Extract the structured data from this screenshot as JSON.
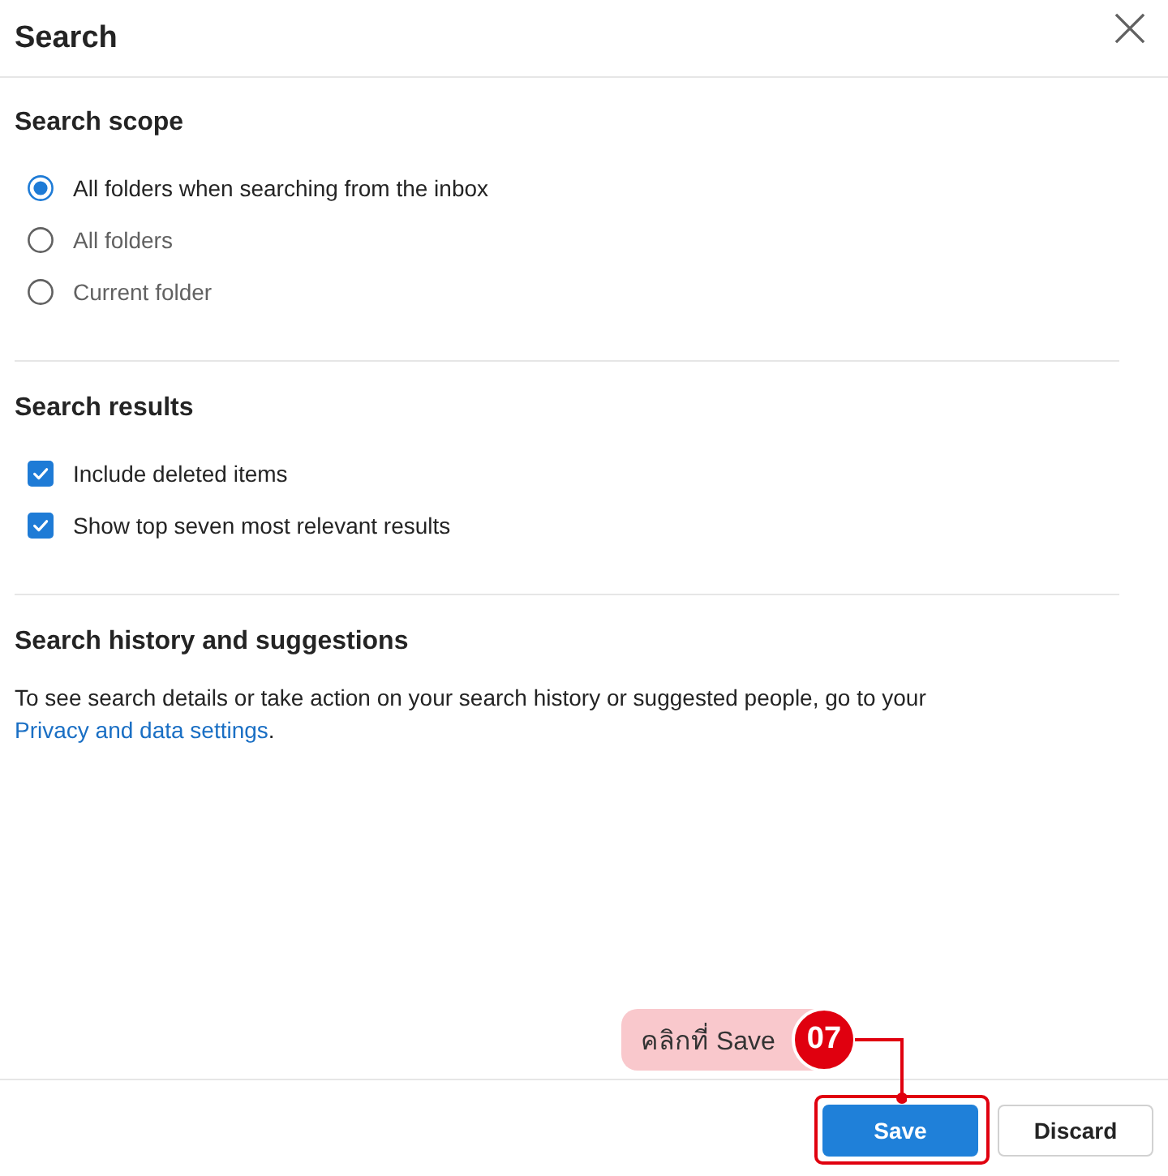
{
  "dialog": {
    "title": "Search"
  },
  "sections": [
    {
      "heading": "Search scope",
      "kind": "radio",
      "options": [
        {
          "label": "All folders when searching from the inbox",
          "selected": true
        },
        {
          "label": "All folders",
          "selected": false
        },
        {
          "label": "Current folder",
          "selected": false
        }
      ]
    },
    {
      "heading": "Search results",
      "kind": "checkbox",
      "options": [
        {
          "label": "Include deleted items",
          "checked": true
        },
        {
          "label": "Show top seven most relevant results",
          "checked": true
        }
      ]
    },
    {
      "heading": "Search history and suggestions",
      "kind": "text",
      "text": "To see search details or take action on your search history or suggested people, go to your",
      "link": "Privacy and data settings",
      "after": "."
    }
  ],
  "buttons": [
    {
      "label": "Save",
      "kind": "primary"
    },
    {
      "label": "Discard",
      "kind": "secondary"
    }
  ],
  "annotation": {
    "text": "คลิกที่ Save",
    "step": "07"
  }
}
